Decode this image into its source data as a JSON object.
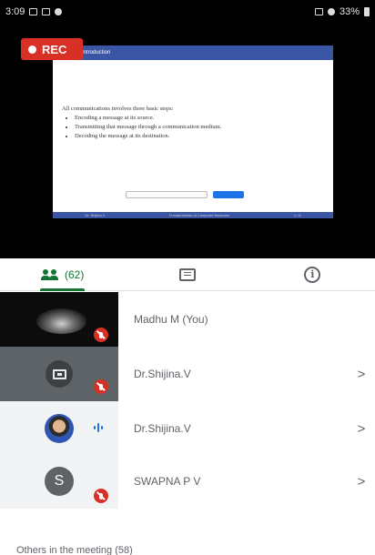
{
  "status_bar": {
    "time": "3:09",
    "battery": "33%"
  },
  "recording": {
    "label": "REC"
  },
  "shared_slide": {
    "header": "Introduction",
    "intro": "All communications involves three basic steps:",
    "bullets": [
      "Encoding a message at its source.",
      "Transmitting that message through a communication medium.",
      "Decoding the message at its destination."
    ],
    "footer": [
      "Dr. Shijina V",
      "Fundamentals of Computer Networks",
      "1 / 8"
    ]
  },
  "tabs": {
    "people_count": "(62)",
    "chat_icon": "chat-icon",
    "info_icon": "info-icon"
  },
  "participants": [
    {
      "name": "Madhu M (You)",
      "thumb": "video",
      "muted": true,
      "chevron": ""
    },
    {
      "name": "Dr.Shijina.V",
      "thumb": "screen-share",
      "muted": true,
      "chevron": ">"
    },
    {
      "name": "Dr.Shijina.V",
      "thumb": "photo",
      "speaking": true,
      "chevron": ">"
    },
    {
      "name": "SWAPNA P V",
      "thumb": "letter",
      "initial": "S",
      "muted": true,
      "chevron": ">"
    }
  ],
  "others_section": {
    "label": "Others in the meeting (58)"
  },
  "colors": {
    "accent_green": "#137333",
    "rec_red": "#d93025",
    "speaking_blue": "#1a73e8"
  }
}
